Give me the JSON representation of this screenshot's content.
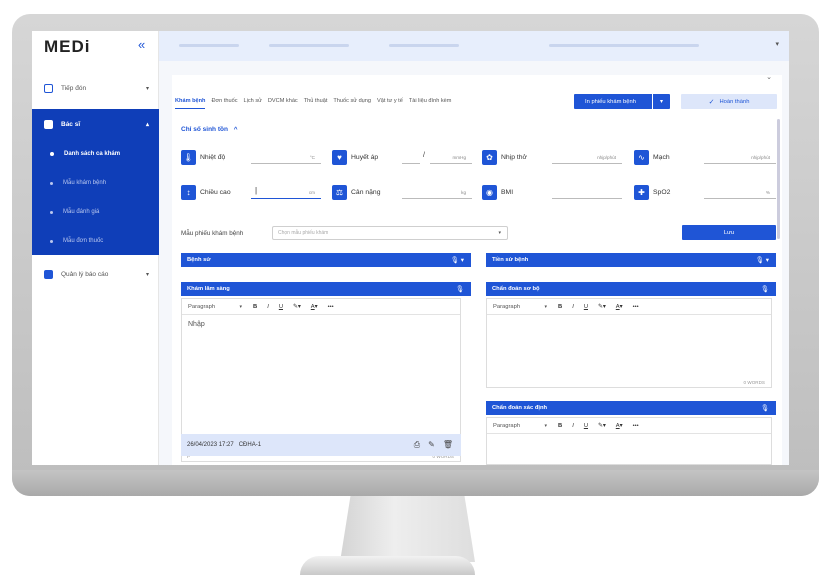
{
  "app": {
    "logo": "MEDi",
    "collapse_icon": "double-chevron-left-icon"
  },
  "sidebar": {
    "items": [
      {
        "label": "Tiếp đón",
        "icon": "calendar-icon"
      },
      {
        "label": "Bác sĩ",
        "icon": "doctor-card-icon"
      },
      {
        "label": "Quản lý báo cáo",
        "icon": "report-icon"
      }
    ],
    "sub_items": [
      {
        "label": "Danh sách ca khám",
        "active": true
      },
      {
        "label": "Mẫu khám bệnh"
      },
      {
        "label": "Mẫu đánh giá"
      },
      {
        "label": "Mẫu đơn thuốc"
      }
    ]
  },
  "tabs": [
    "Khám bệnh",
    "Đơn thuốc",
    "Lịch sử",
    "DVCM khác",
    "Thủ thuật",
    "Thuốc sử dụng",
    "Vật tư y tế",
    "Tài liệu đính kèm"
  ],
  "actions": {
    "print_label": "In phiếu khám bệnh",
    "done_label": "Hoàn thành",
    "save_label": "Lưu"
  },
  "vitals": {
    "title": "Chỉ số sinh tồn",
    "items": [
      {
        "label": "Nhiệt độ",
        "unit": "°C"
      },
      {
        "label": "Huyết áp",
        "unit": "mmHg",
        "separator": "/"
      },
      {
        "label": "Nhịp thở",
        "unit": "nhịp/phút"
      },
      {
        "label": "Mạch",
        "unit": "nhịp/phút"
      },
      {
        "label": "Chiều cao",
        "unit": "cm"
      },
      {
        "label": "Cân nặng",
        "unit": "kg"
      },
      {
        "label": "BMI",
        "unit": ""
      },
      {
        "label": "SpO2",
        "unit": "%"
      }
    ]
  },
  "form": {
    "template_label": "Mẫu phiếu khám bệnh",
    "template_placeholder": "Chọn mẫu phiếu khám"
  },
  "sections": {
    "benh_su": "Bệnh sử",
    "tien_su": "Tiền sử bệnh",
    "kham_lam_sang": "Khám lâm sàng",
    "chan_doan_so_bo": "Chẩn đoán sơ bộ",
    "chan_doan_xac_dinh": "Chẩn đoán xác định"
  },
  "editor": {
    "paragraph": "Paragraph",
    "placeholder": "Nhập",
    "words": "0 WORDS",
    "p_mark": "P",
    "tools": {
      "bold": "B",
      "italic": "I",
      "underline": "U",
      "more": "•••"
    }
  },
  "record": {
    "datetime": "26/04/2023 17:27",
    "code": "CĐHA-1"
  },
  "colors": {
    "primary": "#1f55d6",
    "sidebar_active": "#0f3eb8"
  }
}
